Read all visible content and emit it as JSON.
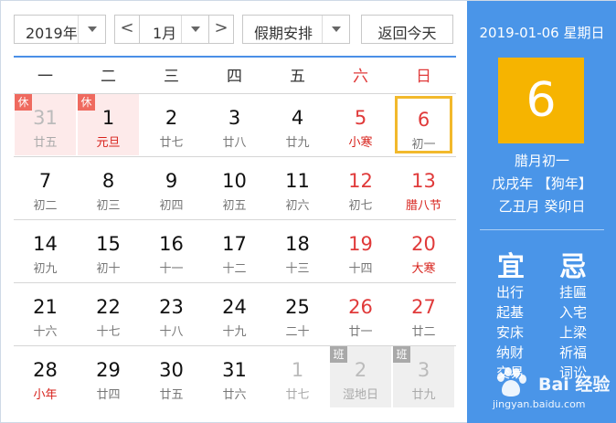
{
  "toolbar": {
    "year": "2019年",
    "month": "1月",
    "prev": "<",
    "next": ">",
    "holiday": "假期安排",
    "today_button": "返回今天"
  },
  "weekdays": [
    "一",
    "二",
    "三",
    "四",
    "五",
    "六",
    "日"
  ],
  "weeks": [
    [
      {
        "day": "31",
        "sub": "廿五",
        "dim": true,
        "badge": "休"
      },
      {
        "day": "1",
        "sub": "元旦",
        "festival": true,
        "badge": "休"
      },
      {
        "day": "2",
        "sub": "廿七"
      },
      {
        "day": "3",
        "sub": "廿八"
      },
      {
        "day": "4",
        "sub": "廿九"
      },
      {
        "day": "5",
        "sub": "小寒",
        "festival": true
      },
      {
        "day": "6",
        "sub": "初一",
        "today": true
      }
    ],
    [
      {
        "day": "7",
        "sub": "初二"
      },
      {
        "day": "8",
        "sub": "初三"
      },
      {
        "day": "9",
        "sub": "初四"
      },
      {
        "day": "10",
        "sub": "初五"
      },
      {
        "day": "11",
        "sub": "初六"
      },
      {
        "day": "12",
        "sub": "初七"
      },
      {
        "day": "13",
        "sub": "腊八节",
        "festival": true
      }
    ],
    [
      {
        "day": "14",
        "sub": "初九"
      },
      {
        "day": "15",
        "sub": "初十"
      },
      {
        "day": "16",
        "sub": "十一"
      },
      {
        "day": "17",
        "sub": "十二"
      },
      {
        "day": "18",
        "sub": "十三"
      },
      {
        "day": "19",
        "sub": "十四"
      },
      {
        "day": "20",
        "sub": "大寒",
        "festival": true
      }
    ],
    [
      {
        "day": "21",
        "sub": "十六"
      },
      {
        "day": "22",
        "sub": "十七"
      },
      {
        "day": "23",
        "sub": "十八"
      },
      {
        "day": "24",
        "sub": "十九"
      },
      {
        "day": "25",
        "sub": "二十"
      },
      {
        "day": "26",
        "sub": "廿一"
      },
      {
        "day": "27",
        "sub": "廿二"
      }
    ],
    [
      {
        "day": "28",
        "sub": "小年",
        "festival": true
      },
      {
        "day": "29",
        "sub": "廿四"
      },
      {
        "day": "30",
        "sub": "廿五"
      },
      {
        "day": "31",
        "sub": "廿六"
      },
      {
        "day": "1",
        "sub": "廿七",
        "dim": true
      },
      {
        "day": "2",
        "sub": "湿地日",
        "dim": true,
        "badge": "班"
      },
      {
        "day": "3",
        "sub": "廿九",
        "dim": true,
        "badge": "班"
      }
    ]
  ],
  "panel": {
    "date": "2019-01-06 星期日",
    "day": "6",
    "lunar": "腊月初一",
    "year_gz": "戊戌年 【狗年】",
    "month_day_gz": "乙丑月 癸卯日",
    "yi_title": "宜",
    "ji_title": "忌",
    "yi": [
      "出行",
      "起基",
      "安床",
      "纳财",
      "交易"
    ],
    "ji": [
      "挂匾",
      "入宅",
      "上梁",
      "祈福",
      "词讼"
    ]
  },
  "watermark": {
    "text": "Bai 经验",
    "url": "jingyan.baidu.com"
  },
  "colors": {
    "accent": "#4a95e8",
    "today_border": "#f2b92c",
    "big_day_bg": "#f6b400",
    "weekend": "#e03a3a"
  }
}
